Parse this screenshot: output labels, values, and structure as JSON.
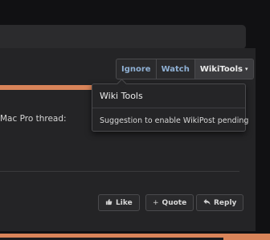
{
  "post": {
    "snippet": "Mac Pro thread:"
  },
  "toolbar": {
    "ignore_label": "Ignore",
    "watch_label": "Watch",
    "wikitools_label": "WikiTools",
    "wikitools_caret": "▾"
  },
  "dropdown": {
    "title": "Wiki Tools",
    "item": "Suggestion to enable WikiPost pending"
  },
  "actions": {
    "like_label": "Like",
    "quote_label": "Quote",
    "reply_label": "Reply",
    "like_icon": "thumbs-up-icon",
    "quote_icon": "plus-icon",
    "reply_icon": "reply-arrow-icon"
  },
  "colors": {
    "accent": "#d98459",
    "link": "#8fb0d4",
    "panel": "#242426",
    "background": "#111113"
  }
}
